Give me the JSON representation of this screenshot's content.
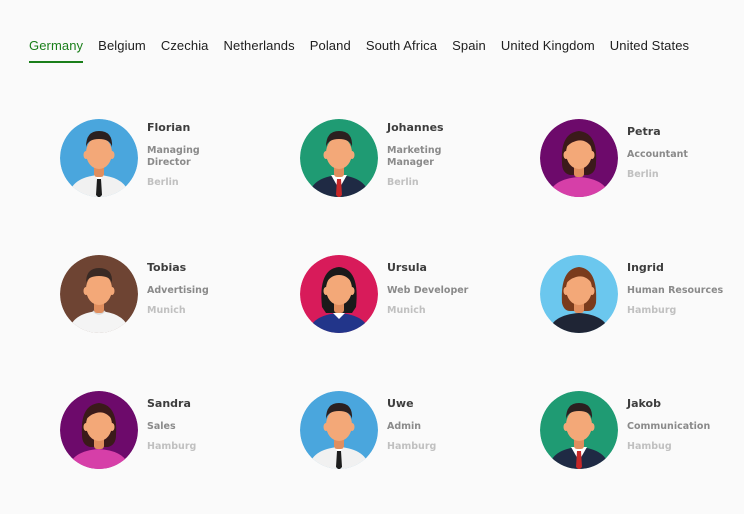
{
  "tabs": [
    {
      "label": "Germany",
      "active": true
    },
    {
      "label": "Belgium",
      "active": false
    },
    {
      "label": "Czechia",
      "active": false
    },
    {
      "label": "Netherlands",
      "active": false
    },
    {
      "label": "Poland",
      "active": false
    },
    {
      "label": "South Africa",
      "active": false
    },
    {
      "label": "Spain",
      "active": false
    },
    {
      "label": "United Kingdom",
      "active": false
    },
    {
      "label": "United States",
      "active": false
    }
  ],
  "colors": {
    "accent": "#1a7f1a",
    "avatar_blue": "#4aa6dd",
    "avatar_green": "#1f9b73",
    "avatar_purple": "#6d0a6b",
    "avatar_brown": "#6e4433",
    "avatar_pink": "#d81b5a",
    "avatar_lightblue": "#6bc7ee"
  },
  "people": [
    {
      "name": "Florian",
      "role": "Managing Director",
      "city": "Berlin",
      "avatar": "man-shirt-tie",
      "bg": "#4aa6dd"
    },
    {
      "name": "Johannes",
      "role": "Marketing Manager",
      "city": "Berlin",
      "avatar": "man-suit-red-tie",
      "bg": "#1f9b73"
    },
    {
      "name": "Petra",
      "role": "Accountant",
      "city": "Berlin",
      "avatar": "woman-pink-top",
      "bg": "#6d0a6b"
    },
    {
      "name": "Tobias",
      "role": "Advertising",
      "city": "Munich",
      "avatar": "man-white-shirt",
      "bg": "#6e4433"
    },
    {
      "name": "Ursula",
      "role": "Web Developer",
      "city": "Munich",
      "avatar": "woman-blue-top",
      "bg": "#d81b5a"
    },
    {
      "name": "Ingrid",
      "role": "Human Resources",
      "city": "Hamburg",
      "avatar": "woman-dark-top",
      "bg": "#6bc7ee"
    },
    {
      "name": "Sandra",
      "role": "Sales",
      "city": "Hamburg",
      "avatar": "woman-pink-top",
      "bg": "#6d0a6b"
    },
    {
      "name": "Uwe",
      "role": "Admin",
      "city": "Hamburg",
      "avatar": "man-shirt-tie",
      "bg": "#4aa6dd"
    },
    {
      "name": "Jakob",
      "role": "Communication",
      "city": "Hambug",
      "avatar": "man-suit-red-tie",
      "bg": "#1f9b73"
    }
  ]
}
